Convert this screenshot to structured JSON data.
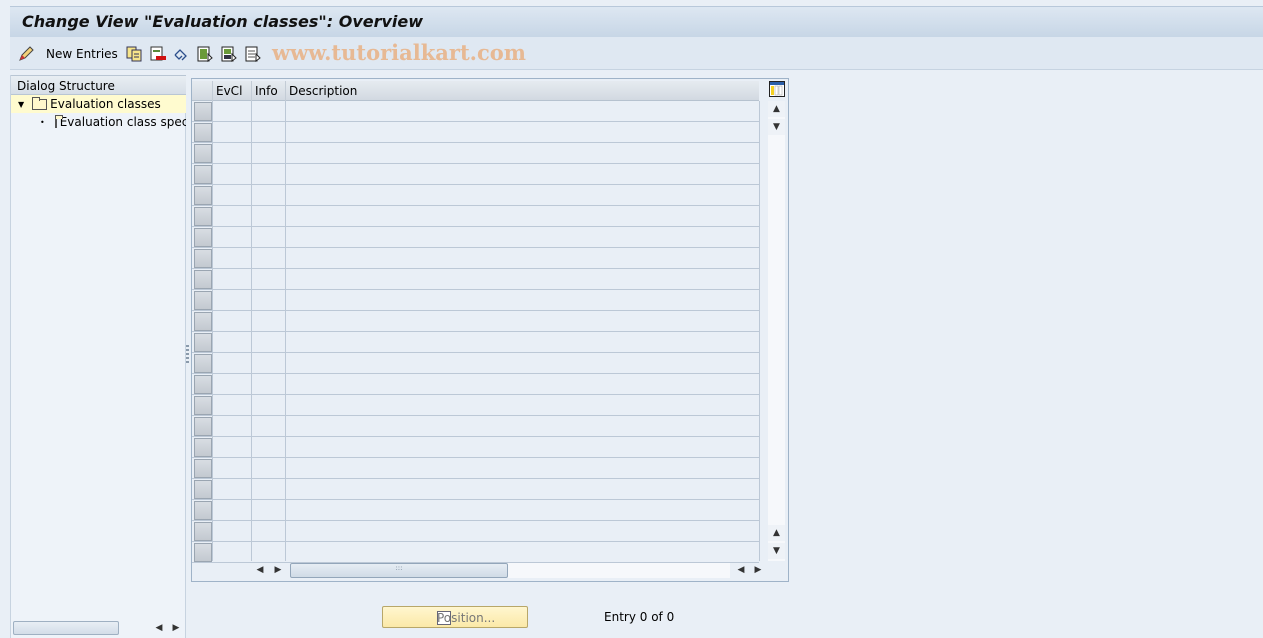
{
  "window": {
    "title": "Change View \"Evaluation classes\": Overview"
  },
  "toolbar": {
    "items": [
      {
        "icon": "change-pencil-icon"
      },
      {
        "label": "New Entries"
      },
      {
        "icon": "copy-icon"
      },
      {
        "icon": "delete-icon"
      },
      {
        "icon": "undo-icon"
      },
      {
        "icon": "select-all-icon"
      },
      {
        "icon": "select-block-icon"
      },
      {
        "icon": "deselect-all-icon"
      }
    ],
    "new_entries_label": "New Entries",
    "watermark": "www.tutorialkart.com"
  },
  "dialog_structure": {
    "header": "Dialog Structure",
    "items": [
      {
        "label": "Evaluation classes",
        "selected": true,
        "expanded": true
      },
      {
        "label": "Evaluation class spec",
        "selected": false
      }
    ]
  },
  "table": {
    "columns": [
      "EvCl",
      "Info",
      "Description"
    ],
    "rows": [],
    "visible_empty_rows": 22
  },
  "footer": {
    "position_button": "Position...",
    "entry_status": "Entry 0 of 0"
  },
  "colors": {
    "background": "#e9eff6",
    "selected_tree": "#fffbcf",
    "position_button": "#fbe9a8",
    "watermark": "#e8b48a"
  }
}
